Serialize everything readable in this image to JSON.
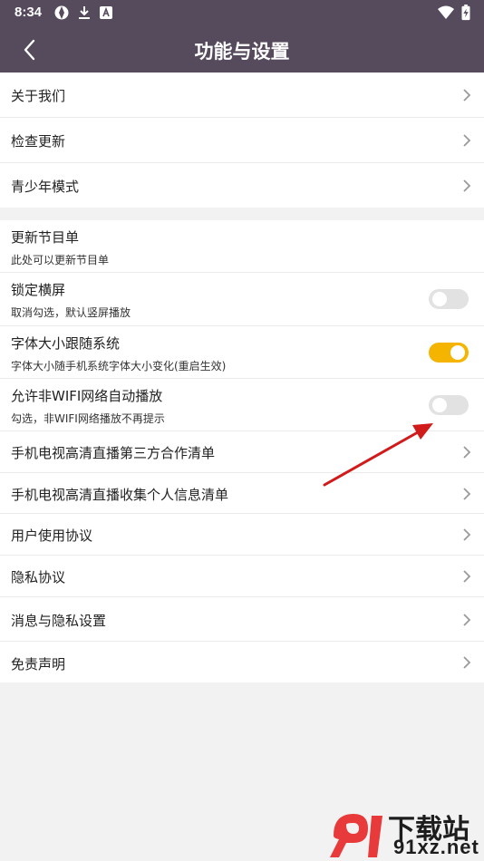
{
  "status_bar": {
    "time": "8:34",
    "icons": [
      "browser-icon",
      "download-icon",
      "a-icon",
      "wifi-icon",
      "battery-charging-icon"
    ]
  },
  "app_bar": {
    "title": "功能与设置",
    "back_icon": "chevron-left-icon"
  },
  "group1": [
    {
      "label": "关于我们"
    },
    {
      "label": "检查更新"
    },
    {
      "label": "青少年模式"
    }
  ],
  "group2": {
    "update_program_list": {
      "label": "更新节目单",
      "sub": "此处可以更新节目单"
    },
    "lock_landscape": {
      "label": "锁定横屏",
      "sub": "取消勾选，默认竖屏播放",
      "on": false
    },
    "font_size_follow": {
      "label": "字体大小跟随系统",
      "sub": "字体大小随手机系统字体大小变化(重启生效)",
      "on": true
    },
    "non_wifi_autoplay": {
      "label": "允许非WIFI网络自动播放",
      "sub": "勾选，非WIFI网络播放不再提示",
      "on": false
    },
    "links": [
      {
        "label": "手机电视高清直播第三方合作清单"
      },
      {
        "label": "手机电视高清直播收集个人信息清单"
      },
      {
        "label": "用户使用协议"
      },
      {
        "label": "隐私协议"
      },
      {
        "label": "消息与隐私设置"
      },
      {
        "label": "免责声明"
      }
    ]
  },
  "watermark": {
    "cn": "下载站",
    "en": "91xz.net"
  },
  "colors": {
    "header": "#564a5d",
    "toggle_on": "#f5b400",
    "toggle_off": "#e2e2e2",
    "annotation_arrow": "#d11a1a"
  }
}
